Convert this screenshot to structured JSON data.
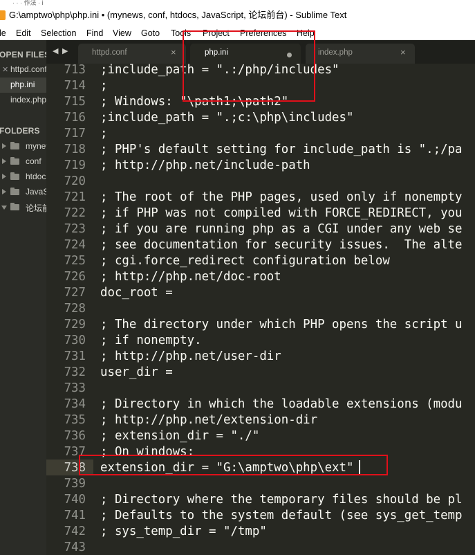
{
  "window": {
    "title": "G:\\amptwo\\php\\php.ini • (mynews, conf, htdocs, JavaScript, 论坛前台) - Sublime Text",
    "top_strip_text": "· · · 作法 · i"
  },
  "menu": {
    "items": [
      "le",
      "Edit",
      "Selection",
      "Find",
      "View",
      "Goto",
      "Tools",
      "Project",
      "Preferences",
      "Help"
    ]
  },
  "sidebar": {
    "open_files_header": "OPEN FILES",
    "open_files": [
      {
        "label": "httpd.conf",
        "active": false
      },
      {
        "label": "php.ini",
        "active": true
      },
      {
        "label": "index.php",
        "active": false
      }
    ],
    "folders_header": "FOLDERS",
    "folders": [
      {
        "label": "mynews",
        "expanded": false
      },
      {
        "label": "conf",
        "expanded": false
      },
      {
        "label": "htdocs",
        "expanded": false
      },
      {
        "label": "JavaScript",
        "expanded": false
      },
      {
        "label": "论坛前台",
        "expanded": true
      }
    ]
  },
  "tabs": {
    "nav_left": "◀",
    "nav_right": "▶",
    "items": [
      {
        "label": "httpd.conf",
        "active": false,
        "dirty": false
      },
      {
        "label": "php.ini",
        "active": true,
        "dirty": true
      },
      {
        "label": "index.php",
        "active": false,
        "dirty": false
      }
    ],
    "close_glyph": "×"
  },
  "editor": {
    "current_line": "738",
    "lines": [
      {
        "num": "713",
        "text": ";include_path = \".:/php/includes\""
      },
      {
        "num": "714",
        "text": ";"
      },
      {
        "num": "715",
        "text": "; Windows: \"\\path1;\\path2\""
      },
      {
        "num": "716",
        "text": ";include_path = \".;c:\\php\\includes\""
      },
      {
        "num": "717",
        "text": ";"
      },
      {
        "num": "718",
        "text": "; PHP's default setting for include_path is \".;/pa"
      },
      {
        "num": "719",
        "text": "; http://php.net/include-path"
      },
      {
        "num": "720",
        "text": ""
      },
      {
        "num": "721",
        "text": "; The root of the PHP pages, used only if nonempty"
      },
      {
        "num": "722",
        "text": "; if PHP was not compiled with FORCE_REDIRECT, you"
      },
      {
        "num": "723",
        "text": "; if you are running php as a CGI under any web se"
      },
      {
        "num": "724",
        "text": "; see documentation for security issues.  The alte"
      },
      {
        "num": "725",
        "text": "; cgi.force_redirect configuration below"
      },
      {
        "num": "726",
        "text": "; http://php.net/doc-root"
      },
      {
        "num": "727",
        "text": "doc_root ="
      },
      {
        "num": "728",
        "text": ""
      },
      {
        "num": "729",
        "text": "; The directory under which PHP opens the script u"
      },
      {
        "num": "730",
        "text": "; if nonempty."
      },
      {
        "num": "731",
        "text": "; http://php.net/user-dir"
      },
      {
        "num": "732",
        "text": "user_dir ="
      },
      {
        "num": "733",
        "text": ""
      },
      {
        "num": "734",
        "text": "; Directory in which the loadable extensions (modu"
      },
      {
        "num": "735",
        "text": "; http://php.net/extension-dir"
      },
      {
        "num": "736",
        "text": "; extension_dir = \"./\""
      },
      {
        "num": "737",
        "text": "; On windows:"
      },
      {
        "num": "738",
        "text": "extension_dir = \"G:\\amptwo\\php\\ext\""
      },
      {
        "num": "739",
        "text": ""
      },
      {
        "num": "740",
        "text": "; Directory where the temporary files should be pl"
      },
      {
        "num": "741",
        "text": "; Defaults to the system default (see sys_get_temp"
      },
      {
        "num": "742",
        "text": "; sys_temp_dir = \"/tmp\""
      },
      {
        "num": "743",
        "text": ""
      }
    ]
  },
  "colors": {
    "editor_bg": "#272822",
    "sidebar_bg": "#2b2c27",
    "annotation": "#e0101a",
    "app_icon": "#f49b1f"
  }
}
